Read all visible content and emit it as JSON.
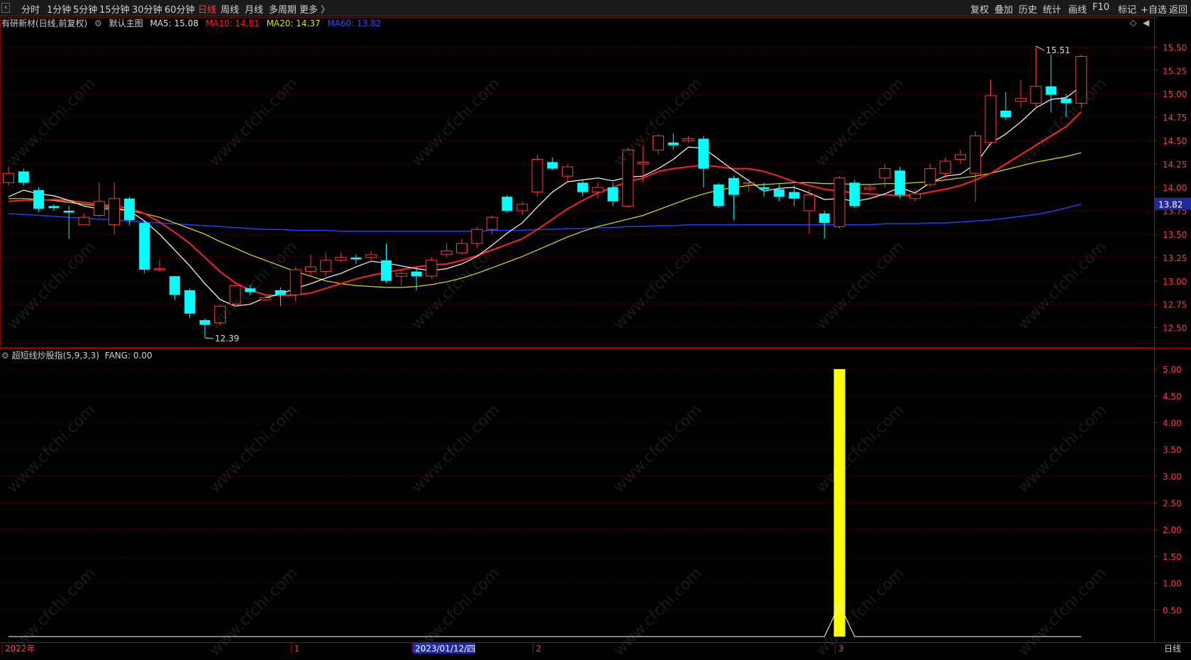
{
  "toolbar": {
    "periods": [
      "分时",
      "1分钟",
      "5分钟",
      "15分钟",
      "30分钟",
      "60分钟",
      "日线",
      "周线",
      "月线",
      "多周期",
      "更多 〉"
    ],
    "active_period": "日线",
    "right_buttons": [
      "复权",
      "叠加",
      "历史",
      "统计",
      "画线",
      "F10",
      "标记",
      "+自选",
      "返回"
    ]
  },
  "legend": {
    "stock": "有研新材(日线,前复权)",
    "main_chart": "默认主图",
    "ma5": "MA5: 15.08",
    "ma10": "MA10: 14.81",
    "ma20": "MA20: 14.37",
    "ma60": "MA60: 13.82"
  },
  "indicator": {
    "name": "超短线炒股指(5,9,3,3)",
    "value": "FANG: 0.00"
  },
  "watermark": "www.cfchi.com",
  "colors": {
    "up": "#ff3b3b",
    "down": "#00ffff",
    "ma5": "#ffffff",
    "ma10": "#ff2020",
    "ma20": "#e0e000",
    "ma60": "#1f3fff",
    "grid": "#7a0000",
    "bar": "#ffff00"
  },
  "chart_data": {
    "type": "candlestick",
    "price_axis": {
      "ticks": [
        "15.50",
        "15.25",
        "15.00",
        "14.75",
        "14.50",
        "14.25",
        "14.00",
        "13.75",
        "13.50",
        "13.25",
        "13.00",
        "12.75",
        "12.50"
      ],
      "range": [
        12.3,
        15.7
      ],
      "current_price_label": "13.82"
    },
    "annotations": {
      "high_label": "15.51",
      "low_label": "12.39"
    },
    "candles": [
      [
        14.05,
        14.15,
        14.22,
        14.02
      ],
      [
        14.17,
        14.05,
        14.2,
        14.02
      ],
      [
        13.97,
        13.77,
        14.0,
        13.74
      ],
      [
        13.8,
        13.78,
        13.82,
        13.75
      ],
      [
        13.75,
        13.73,
        13.8,
        13.45
      ],
      [
        13.6,
        13.68,
        13.72,
        13.6
      ],
      [
        13.7,
        13.85,
        14.05,
        13.68
      ],
      [
        13.6,
        13.88,
        14.05,
        13.5
      ],
      [
        13.88,
        13.65,
        13.9,
        13.6
      ],
      [
        13.62,
        13.12,
        13.65,
        13.08
      ],
      [
        13.12,
        13.13,
        13.23,
        13.1
      ],
      [
        13.05,
        12.85,
        13.05,
        12.8
      ],
      [
        12.9,
        12.65,
        12.92,
        12.6
      ],
      [
        12.58,
        12.53,
        12.6,
        12.39
      ],
      [
        12.55,
        12.73,
        12.75,
        12.52
      ],
      [
        12.75,
        12.95,
        12.97,
        12.73
      ],
      [
        12.92,
        12.88,
        12.96,
        12.85
      ],
      [
        12.8,
        12.82,
        12.85,
        12.78
      ],
      [
        12.9,
        12.85,
        12.93,
        12.73
      ],
      [
        12.85,
        13.12,
        13.15,
        12.78
      ],
      [
        13.1,
        13.15,
        13.28,
        13.05
      ],
      [
        13.1,
        13.22,
        13.3,
        13.05
      ],
      [
        13.22,
        13.25,
        13.3,
        13.2
      ],
      [
        13.25,
        13.23,
        13.28,
        13.18
      ],
      [
        13.25,
        13.28,
        13.32,
        13.2
      ],
      [
        13.22,
        13.0,
        13.4,
        12.98
      ],
      [
        13.05,
        13.08,
        13.12,
        12.95
      ],
      [
        13.1,
        13.05,
        13.15,
        12.9
      ],
      [
        13.05,
        13.22,
        13.25,
        13.02
      ],
      [
        13.28,
        13.32,
        13.4,
        13.25
      ],
      [
        13.3,
        13.4,
        13.45,
        13.28
      ],
      [
        13.4,
        13.55,
        13.58,
        13.35
      ],
      [
        13.55,
        13.68,
        13.7,
        13.5
      ],
      [
        13.9,
        13.75,
        13.92,
        13.73
      ],
      [
        13.75,
        13.82,
        13.85,
        13.7
      ],
      [
        13.95,
        14.3,
        14.35,
        13.9
      ],
      [
        14.27,
        14.2,
        14.32,
        14.18
      ],
      [
        14.12,
        14.22,
        14.25,
        14.05
      ],
      [
        14.05,
        13.95,
        14.08,
        13.9
      ],
      [
        13.95,
        14.0,
        14.05,
        13.88
      ],
      [
        14.0,
        13.85,
        14.05,
        13.8
      ],
      [
        13.8,
        14.4,
        14.42,
        13.78
      ],
      [
        14.25,
        14.27,
        14.45,
        14.05
      ],
      [
        14.4,
        14.55,
        14.57,
        14.35
      ],
      [
        14.48,
        14.45,
        14.58,
        14.4
      ],
      [
        14.5,
        14.52,
        14.55,
        14.48
      ],
      [
        14.52,
        14.2,
        14.55,
        14.0
      ],
      [
        14.03,
        13.8,
        14.05,
        13.78
      ],
      [
        14.1,
        13.92,
        14.12,
        13.65
      ],
      [
        14.05,
        14.05,
        14.1,
        13.95
      ],
      [
        14.0,
        13.98,
        14.05,
        13.9
      ],
      [
        13.98,
        13.9,
        14.03,
        13.85
      ],
      [
        13.95,
        13.88,
        14.02,
        13.8
      ],
      [
        13.75,
        13.92,
        13.98,
        13.5
      ],
      [
        13.72,
        13.62,
        13.75,
        13.45
      ],
      [
        13.58,
        14.1,
        14.12,
        13.56
      ],
      [
        14.05,
        13.8,
        14.08,
        13.78
      ],
      [
        13.98,
        14.0,
        14.02,
        13.95
      ],
      [
        14.1,
        14.2,
        14.25,
        14.0
      ],
      [
        14.18,
        13.92,
        14.22,
        13.88
      ],
      [
        13.88,
        13.93,
        13.98,
        13.85
      ],
      [
        14.03,
        14.2,
        14.25,
        14.0
      ],
      [
        14.15,
        14.28,
        14.32,
        14.1
      ],
      [
        14.3,
        14.35,
        14.4,
        14.25
      ],
      [
        14.15,
        14.55,
        14.6,
        13.85
      ],
      [
        14.48,
        14.98,
        15.15,
        14.45
      ],
      [
        14.82,
        14.75,
        15.02,
        14.72
      ],
      [
        14.92,
        14.95,
        15.15,
        14.85
      ],
      [
        14.9,
        15.08,
        15.51,
        14.85
      ],
      [
        15.08,
        14.99,
        15.42,
        14.8
      ],
      [
        14.95,
        14.9,
        15.0,
        14.75
      ],
      [
        14.9,
        15.4,
        15.42,
        14.85
      ]
    ],
    "ma5": [
      13.9,
      13.97,
      13.93,
      13.91,
      13.86,
      13.8,
      13.77,
      13.77,
      13.75,
      13.64,
      13.5,
      13.33,
      13.16,
      12.97,
      12.8,
      12.73,
      12.75,
      12.82,
      12.86,
      12.92,
      12.97,
      13.03,
      13.08,
      13.15,
      13.21,
      13.19,
      13.16,
      13.13,
      13.11,
      13.13,
      13.18,
      13.26,
      13.38,
      13.51,
      13.62,
      13.79,
      13.95,
      14.06,
      14.08,
      14.1,
      14.07,
      14.11,
      14.12,
      14.2,
      14.3,
      14.43,
      14.42,
      14.3,
      14.18,
      14.07,
      13.96,
      13.99,
      14.0,
      13.94,
      13.87,
      13.88,
      13.85,
      13.88,
      13.93,
      14.0,
      13.94,
      14.05,
      14.12,
      14.14,
      14.25,
      14.47,
      14.57,
      14.7,
      14.85,
      14.94,
      14.96,
      15.08
    ],
    "ma10": [
      13.85,
      13.86,
      13.86,
      13.87,
      13.86,
      13.84,
      13.82,
      13.8,
      13.78,
      13.72,
      13.63,
      13.52,
      13.4,
      13.25,
      13.1,
      12.98,
      12.9,
      12.85,
      12.84,
      12.85,
      12.87,
      12.92,
      12.97,
      13.02,
      13.06,
      13.09,
      13.12,
      13.15,
      13.17,
      13.18,
      13.22,
      13.27,
      13.33,
      13.39,
      13.45,
      13.55,
      13.66,
      13.77,
      13.86,
      13.94,
      14.0,
      14.06,
      14.1,
      14.17,
      14.2,
      14.22,
      14.24,
      14.22,
      14.2,
      14.2,
      14.17,
      14.12,
      14.06,
      14.02,
      13.98,
      13.96,
      13.94,
      13.93,
      13.92,
      13.91,
      13.92,
      13.95,
      13.98,
      14.02,
      14.08,
      14.15,
      14.25,
      14.35,
      14.45,
      14.55,
      14.65,
      14.81
    ],
    "ma20": [
      13.88,
      13.88,
      13.87,
      13.86,
      13.84,
      13.82,
      13.8,
      13.78,
      13.75,
      13.72,
      13.68,
      13.62,
      13.56,
      13.5,
      13.42,
      13.35,
      13.28,
      13.22,
      13.16,
      13.1,
      13.05,
      13.0,
      12.97,
      12.95,
      12.94,
      12.93,
      12.93,
      12.94,
      12.96,
      12.99,
      13.03,
      13.08,
      13.14,
      13.2,
      13.26,
      13.33,
      13.4,
      13.47,
      13.53,
      13.58,
      13.62,
      13.66,
      13.7,
      13.76,
      13.82,
      13.88,
      13.93,
      13.97,
      14.0,
      14.02,
      14.03,
      14.04,
      14.05,
      14.05,
      14.04,
      14.04,
      14.03,
      14.03,
      14.04,
      14.04,
      14.05,
      14.06,
      14.08,
      14.1,
      14.12,
      14.15,
      14.19,
      14.23,
      14.27,
      14.3,
      14.33,
      14.37
    ],
    "ma60": [
      13.72,
      13.71,
      13.7,
      13.69,
      13.68,
      13.67,
      13.66,
      13.65,
      13.64,
      13.63,
      13.62,
      13.61,
      13.6,
      13.59,
      13.58,
      13.57,
      13.56,
      13.55,
      13.55,
      13.54,
      13.54,
      13.54,
      13.53,
      13.53,
      13.53,
      13.53,
      13.53,
      13.53,
      13.53,
      13.53,
      13.53,
      13.53,
      13.54,
      13.54,
      13.54,
      13.55,
      13.55,
      13.56,
      13.56,
      13.57,
      13.57,
      13.58,
      13.58,
      13.59,
      13.59,
      13.6,
      13.6,
      13.6,
      13.6,
      13.6,
      13.6,
      13.6,
      13.6,
      13.6,
      13.6,
      13.6,
      13.6,
      13.6,
      13.61,
      13.61,
      13.61,
      13.62,
      13.62,
      13.63,
      13.64,
      13.65,
      13.67,
      13.69,
      13.71,
      13.74,
      13.78,
      13.82
    ],
    "sub_axis": {
      "ticks": [
        "5.00",
        "4.50",
        "4.00",
        "3.50",
        "3.00",
        "2.50",
        "2.00",
        "1.50",
        "1.00",
        "0.50"
      ],
      "range": [
        0,
        5.2
      ]
    },
    "fang_bar_index": 55,
    "fang_bar_value": 5.0,
    "fang_line": [
      0,
      0,
      0,
      0,
      0,
      0,
      0,
      0,
      0,
      0,
      0,
      0,
      0,
      0,
      0,
      0,
      0,
      0,
      0,
      0,
      0,
      0,
      0,
      0,
      0,
      0,
      0,
      0,
      0,
      0,
      0,
      0,
      0,
      0,
      0,
      0,
      0,
      0,
      0,
      0,
      0,
      0,
      0,
      0,
      0,
      0,
      0,
      0,
      0,
      0,
      0,
      0,
      0,
      0,
      0,
      0.6,
      0,
      0,
      0,
      0,
      0,
      0,
      0,
      0,
      0,
      0,
      0,
      0,
      0,
      0,
      0,
      0
    ]
  },
  "x_axis": {
    "labels": [
      "2022年",
      "1",
      "2023/01/12/四",
      "2",
      "3"
    ],
    "label_indices": [
      0,
      19,
      27,
      35,
      55
    ],
    "highlight_index": 27
  },
  "bottom_right_label": "日线"
}
